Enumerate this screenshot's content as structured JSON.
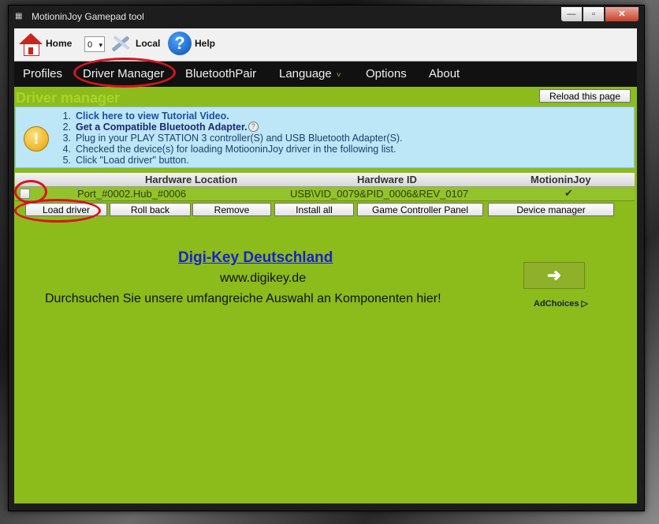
{
  "window": {
    "title": "MotioninJoy Gamepad tool",
    "min": "—",
    "max": "▫",
    "close": "✕"
  },
  "toolbar": {
    "home_label": "Home",
    "select_value": "0",
    "local_label": "Local",
    "help_label": "Help",
    "help_glyph": "?"
  },
  "nav": {
    "items": [
      "Profiles",
      "Driver Manager",
      "BluetoothPair",
      "Language",
      "Options",
      "About"
    ],
    "caret": "˅"
  },
  "page": {
    "title": "Driver manager",
    "reload_label": "Reload this page"
  },
  "info": {
    "warn_glyph": "!",
    "steps": [
      {
        "num": "1.",
        "text": "Click here to view Tutorial Video."
      },
      {
        "num": "2.",
        "text": "Get a Compatible Bluetooth Adapter."
      },
      {
        "num": "3.",
        "text": "Plug in your PLAY STATION 3 controller(S) and USB Bluetooth Adapter(S)."
      },
      {
        "num": "4.",
        "text": "Checked the device(s) for loading MotiooninJoy driver in the following list."
      },
      {
        "num": "5.",
        "text": "Click \"Load driver\" button."
      }
    ],
    "qmark": "?"
  },
  "table": {
    "headers": [
      "Hardware Location",
      "Hardware ID",
      "MotioninJoy"
    ],
    "rows": [
      {
        "location": "Port_#0002.Hub_#0006",
        "id": "USB\\VID_0079&PID_0006&REV_0107",
        "motioninjoy": "✔"
      }
    ]
  },
  "actions": [
    "Load driver",
    "Roll back",
    "Remove",
    "Install all",
    "Game Controller Panel",
    "Device manager"
  ],
  "ad": {
    "title": "Digi-Key Deutschland",
    "url": "www.digikey.de",
    "description": "Durchsuchen Sie unsere umfangreiche Auswahl an Komponenten hier!",
    "arrow": "➜",
    "adchoices": "AdChoices ▷"
  },
  "colors": {
    "accent": "#8cbb1c",
    "annotation": "#d8141e",
    "nav_bg": "#111111"
  }
}
